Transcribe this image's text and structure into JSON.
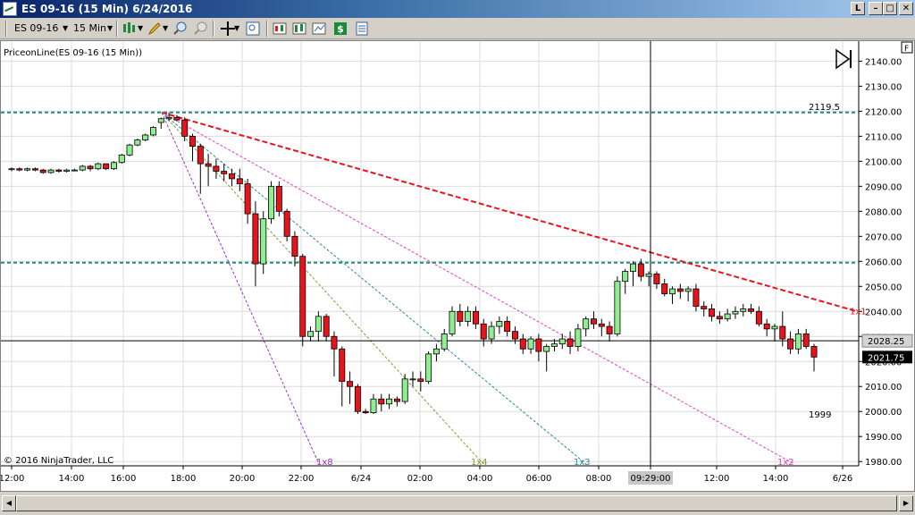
{
  "window": {
    "title": "ES 09-16 (15 Min)  6/24/2016",
    "buttons": [
      "L",
      "–",
      "□",
      "✕"
    ]
  },
  "toolbar": {
    "instrument": "ES 09-16",
    "interval": "15 Min"
  },
  "indicator_label": "PriceonLine(ES 09-16 (15 Min))",
  "copyright": "© 2016 NinjaTrader, LLC",
  "f_badge": "F",
  "colors": {
    "up": "#90ee90",
    "down": "#e8141c",
    "fan_red": "#e8141c",
    "hline": "#1e8a8a",
    "fan_1x8": "#9b30d0",
    "fan_1x4": "#8a9a30",
    "fan_1x3": "#2a8aa0",
    "fan_1x2": "#e040c0"
  },
  "chart_data": {
    "type": "candlestick",
    "title": "",
    "ylim": [
      1978,
      2145
    ],
    "y_ticks": [
      1980,
      1990,
      2000,
      2010,
      2020,
      2030,
      2040,
      2050,
      2060,
      2070,
      2080,
      2090,
      2100,
      2110,
      2120,
      2130,
      2140
    ],
    "y_tick_labels": [
      "1980.00",
      "1990.00",
      "2000.00",
      "2010.00",
      "2020.00",
      "2030.00",
      "2040.00",
      "2050.00",
      "2060.00",
      "2070.00",
      "2080.00",
      "2090.00",
      "2100.00",
      "2110.00",
      "2120.00",
      "2130.00",
      "2140.00"
    ],
    "x_ticks": [
      "12:00",
      "14:00",
      "16:00",
      "18:00",
      "20:00",
      "22:00",
      "6/24",
      "02:00",
      "04:00",
      "06:00",
      "08:00",
      "09:29:00",
      "12:00",
      "14:00",
      "6/26"
    ],
    "crosshair": {
      "time_label": "09:29:00",
      "price": 2028.25,
      "price_label": "2028.25"
    },
    "last_price": {
      "value": 2021.75,
      "label": "2021.75"
    },
    "horizontal_lines": [
      {
        "value": 2119.5,
        "label": "2119.5"
      },
      {
        "value": 2059.5,
        "label": ""
      }
    ],
    "annotations": [
      {
        "text": "1999",
        "value": 1999
      },
      {
        "text": "1x1",
        "value": 2040
      },
      {
        "text": "1x8",
        "value": 1979
      },
      {
        "text": "1x4",
        "value": 1979
      },
      {
        "text": "1x3",
        "value": 1979
      },
      {
        "text": "1x2",
        "value": 1979
      }
    ],
    "candles": [
      [
        2097,
        2097.5,
        2096,
        2097
      ],
      [
        2097,
        2097.5,
        2096,
        2096.5
      ],
      [
        2096.5,
        2097.5,
        2096,
        2097
      ],
      [
        2097,
        2097.5,
        2096,
        2096.5
      ],
      [
        2096.5,
        2097,
        2095,
        2095.5
      ],
      [
        2095.5,
        2097,
        2095,
        2096.5
      ],
      [
        2096.5,
        2097,
        2095.5,
        2096
      ],
      [
        2096,
        2097,
        2095.5,
        2096.5
      ],
      [
        2096.5,
        2097,
        2096,
        2096.5
      ],
      [
        2096.5,
        2098.5,
        2096,
        2098
      ],
      [
        2098,
        2098.5,
        2096,
        2097
      ],
      [
        2097,
        2099.5,
        2096.5,
        2099
      ],
      [
        2099,
        2099,
        2096.5,
        2097
      ],
      [
        2097,
        2100,
        2096.5,
        2099.5
      ],
      [
        2099.5,
        2103,
        2099,
        2102.5
      ],
      [
        2102.5,
        2107,
        2102,
        2106.5
      ],
      [
        2106.5,
        2109,
        2106,
        2108.5
      ],
      [
        2108.5,
        2111,
        2108,
        2110.5
      ],
      [
        2110.5,
        2114,
        2110,
        2113.5
      ],
      [
        2115.5,
        2117.5,
        2113,
        2117
      ],
      [
        2117,
        2119.5,
        2116,
        2117.5
      ],
      [
        2117.5,
        2118.5,
        2116,
        2116.5
      ],
      [
        2116.5,
        2117.5,
        2108,
        2110
      ],
      [
        2110,
        2111,
        2100,
        2106
      ],
      [
        2106,
        2107,
        2087,
        2099
      ],
      [
        2099,
        2103,
        2090,
        2098
      ],
      [
        2098,
        2101,
        2093,
        2096
      ],
      [
        2096,
        2099,
        2092,
        2095
      ],
      [
        2095,
        2097,
        2090,
        2093
      ],
      [
        2093,
        2097,
        2088,
        2091
      ],
      [
        2091,
        2093,
        2075,
        2079
      ],
      [
        2079,
        2084,
        2050,
        2059
      ],
      [
        2059,
        2080,
        2055,
        2077
      ],
      [
        2077,
        2092,
        2075,
        2090
      ],
      [
        2090,
        2092,
        2078,
        2080
      ],
      [
        2080,
        2081,
        2068,
        2070
      ],
      [
        2070,
        2072,
        2058,
        2062
      ],
      [
        2062,
        2063,
        2026,
        2030
      ],
      [
        2030,
        2034,
        2028,
        2032
      ],
      [
        2032,
        2040,
        2028,
        2038
      ],
      [
        2038,
        2039,
        2028,
        2030
      ],
      [
        2030,
        2032,
        2014,
        2025
      ],
      [
        2025,
        2026,
        2002,
        2012
      ],
      [
        2012,
        2016,
        2003,
        2010
      ],
      [
        2010,
        2011,
        1999,
        2000
      ],
      [
        2000,
        2001,
        1999,
        1999.5
      ],
      [
        1999.5,
        2007,
        1999,
        2005
      ],
      [
        2005,
        2007,
        2000,
        2003
      ],
      [
        2003,
        2007,
        2001,
        2005
      ],
      [
        2005,
        2006,
        2002,
        2004
      ],
      [
        2004,
        2015,
        2003,
        2013
      ],
      [
        2013,
        2016,
        2010,
        2013
      ],
      [
        2013,
        2016,
        2008,
        2012
      ],
      [
        2012,
        2024,
        2011,
        2023
      ],
      [
        2023,
        2027,
        2020,
        2025
      ],
      [
        2025,
        2033,
        2024,
        2031
      ],
      [
        2031,
        2042,
        2030,
        2040
      ],
      [
        2040,
        2043,
        2034,
        2036
      ],
      [
        2036,
        2042,
        2034,
        2040
      ],
      [
        2040,
        2042,
        2033,
        2035
      ],
      [
        2035,
        2037,
        2026,
        2029
      ],
      [
        2029,
        2036,
        2027,
        2034
      ],
      [
        2034,
        2038,
        2031,
        2036
      ],
      [
        2036,
        2038,
        2030,
        2032
      ],
      [
        2032,
        2034,
        2027,
        2029
      ],
      [
        2029,
        2031,
        2023,
        2025
      ],
      [
        2025,
        2030,
        2023,
        2029
      ],
      [
        2029,
        2031,
        2020,
        2024
      ],
      [
        2024,
        2027,
        2016,
        2026
      ],
      [
        2026,
        2029,
        2024,
        2027
      ],
      [
        2027,
        2031,
        2025,
        2029
      ],
      [
        2029,
        2032,
        2023,
        2026
      ],
      [
        2026,
        2035,
        2024,
        2033
      ],
      [
        2033,
        2038,
        2030,
        2037
      ],
      [
        2037,
        2040,
        2033,
        2035
      ],
      [
        2035,
        2037,
        2030,
        2034
      ],
      [
        2034,
        2036,
        2028,
        2031
      ],
      [
        2031,
        2054,
        2030,
        2052
      ],
      [
        2052,
        2057,
        2047,
        2056
      ],
      [
        2056,
        2060,
        2050,
        2059
      ],
      [
        2059,
        2061,
        2052,
        2054
      ],
      [
        2054,
        2056,
        2050,
        2055
      ],
      [
        2055,
        2056,
        2049,
        2051
      ],
      [
        2051,
        2053,
        2046,
        2047
      ],
      [
        2047,
        2050,
        2043,
        2049
      ],
      [
        2049,
        2051,
        2045,
        2048
      ],
      [
        2048,
        2050,
        2044,
        2049
      ],
      [
        2049,
        2051,
        2040,
        2042
      ],
      [
        2042,
        2044,
        2038,
        2041
      ],
      [
        2041,
        2043,
        2036,
        2038
      ],
      [
        2038,
        2040,
        2035,
        2037
      ],
      [
        2037,
        2041,
        2036,
        2039
      ],
      [
        2039,
        2042,
        2037,
        2040
      ],
      [
        2040,
        2043,
        2038,
        2041
      ],
      [
        2041,
        2043,
        2039,
        2040
      ],
      [
        2040,
        2042,
        2034,
        2035
      ],
      [
        2035,
        2037,
        2030,
        2033
      ],
      [
        2033,
        2035,
        2028,
        2034
      ],
      [
        2034,
        2040,
        2026,
        2029
      ],
      [
        2029,
        2032,
        2023,
        2025
      ],
      [
        2025,
        2033,
        2023,
        2031
      ],
      [
        2031,
        2033,
        2025,
        2026
      ],
      [
        2026,
        2027,
        2016,
        2021.75
      ]
    ]
  }
}
